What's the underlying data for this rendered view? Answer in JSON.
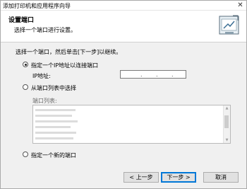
{
  "window": {
    "title": "添加打印机和应用程序向导",
    "close_glyph": "✕"
  },
  "header": {
    "title": "设置端口",
    "subtitle": "选择一个端口进行设置。",
    "icon": "port-setup-icon"
  },
  "main": {
    "prompt": "选择一个端口，然后单击[下一步]以继续。",
    "option_ip": {
      "label": "指定一个IP地址以连接端口",
      "checked": true
    },
    "ip_label": "IP地址:",
    "ip_value": ". . .",
    "option_list": {
      "label": "从端口列表中选择",
      "checked": false
    },
    "ports_label": "端口列表:",
    "ports": [
      "",
      "",
      "",
      "",
      "",
      ""
    ],
    "option_new": {
      "label": "指定一个新的端口",
      "checked": false
    }
  },
  "footer": {
    "back_label": "< 上一步",
    "next_label": "下一步 >",
    "cancel_label": "取消"
  },
  "colors": {
    "accent": "#0078d7",
    "window_bg": "#f0f0f0",
    "header_bg": "#ffffff"
  }
}
